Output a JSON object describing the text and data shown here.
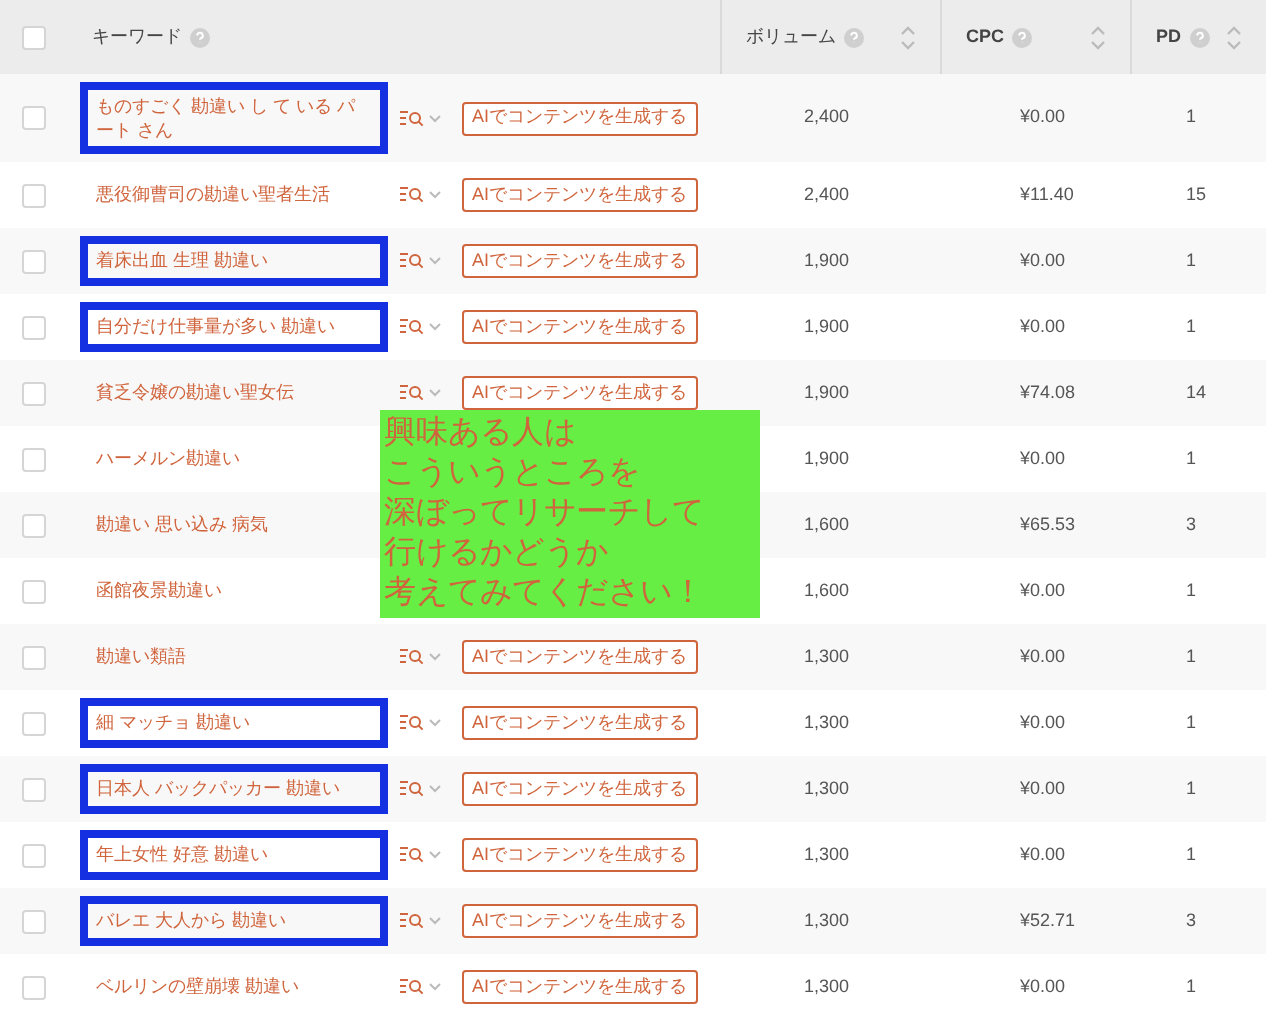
{
  "table": {
    "select_all_checked": false,
    "columns": [
      {
        "label": "キーワード",
        "sortable": false
      },
      {
        "label": "ボリューム",
        "sortable": true
      },
      {
        "label": "CPC",
        "sortable": true
      },
      {
        "label": "PD",
        "sortable": true
      }
    ],
    "rows": [
      {
        "checked": false,
        "keyword": "ものすごく 勘違い し て いる パート さん",
        "highlighted": true,
        "button": "AIでコンテンツを生成する",
        "volume": "2,400",
        "cpc": "¥0.00",
        "pd": "1"
      },
      {
        "checked": false,
        "keyword": "悪役御曹司の勘違い聖者生活",
        "highlighted": false,
        "button": "AIでコンテンツを生成する",
        "volume": "2,400",
        "cpc": "¥11.40",
        "pd": "15"
      },
      {
        "checked": false,
        "keyword": "着床出血 生理 勘違い",
        "highlighted": true,
        "button": "AIでコンテンツを生成する",
        "volume": "1,900",
        "cpc": "¥0.00",
        "pd": "1"
      },
      {
        "checked": false,
        "keyword": "自分だけ仕事量が多い 勘違い",
        "highlighted": true,
        "button": "AIでコンテンツを生成する",
        "volume": "1,900",
        "cpc": "¥0.00",
        "pd": "1"
      },
      {
        "checked": false,
        "keyword": "貧乏令嬢の勘違い聖女伝",
        "highlighted": false,
        "button": "AIでコンテンツを生成する",
        "volume": "1,900",
        "cpc": "¥74.08",
        "pd": "14"
      },
      {
        "checked": false,
        "keyword": "ハーメルン勘違い",
        "highlighted": false,
        "volume": "1,900",
        "cpc": "¥0.00",
        "pd": "1"
      },
      {
        "checked": false,
        "keyword": "勘違い 思い込み 病気",
        "highlighted": false,
        "volume": "1,600",
        "cpc": "¥65.53",
        "pd": "3"
      },
      {
        "checked": false,
        "keyword": "函館夜景勘違い",
        "highlighted": false,
        "volume": "1,600",
        "cpc": "¥0.00",
        "pd": "1"
      },
      {
        "checked": false,
        "keyword": "勘違い類語",
        "highlighted": false,
        "button": "AIでコンテンツを生成する",
        "volume": "1,300",
        "cpc": "¥0.00",
        "pd": "1"
      },
      {
        "checked": false,
        "keyword": "細 マッチョ 勘違い",
        "highlighted": true,
        "button": "AIでコンテンツを生成する",
        "volume": "1,300",
        "cpc": "¥0.00",
        "pd": "1"
      },
      {
        "checked": false,
        "keyword": "日本人 バックパッカー 勘違い",
        "highlighted": true,
        "button": "AIでコンテンツを生成する",
        "volume": "1,300",
        "cpc": "¥0.00",
        "pd": "1"
      },
      {
        "checked": false,
        "keyword": "年上女性 好意 勘違い",
        "highlighted": true,
        "button": "AIでコンテンツを生成する",
        "volume": "1,300",
        "cpc": "¥0.00",
        "pd": "1"
      },
      {
        "checked": false,
        "keyword": "バレエ 大人から 勘違い",
        "highlighted": true,
        "button": "AIでコンテンツを生成する",
        "volume": "1,300",
        "cpc": "¥52.71",
        "pd": "3"
      },
      {
        "checked": false,
        "keyword": "ベルリンの壁崩壊 勘違い",
        "highlighted": false,
        "button": "AIでコンテンツを生成する",
        "volume": "1,300",
        "cpc": "¥0.00",
        "pd": "1"
      }
    ]
  },
  "note": {
    "lines": [
      "興味ある人は",
      "こういうところを",
      "深ぼってリサーチして",
      "行けるかどうか",
      "考えてみてください！"
    ]
  }
}
